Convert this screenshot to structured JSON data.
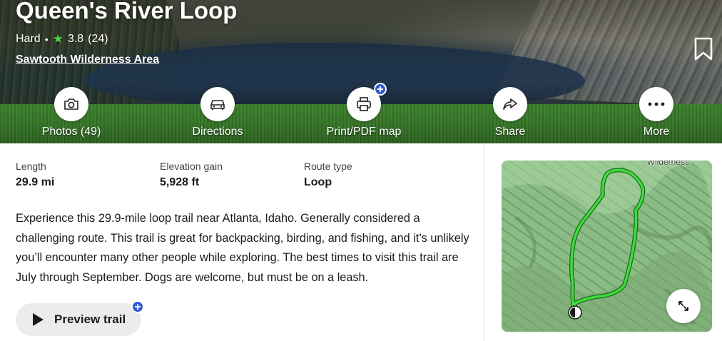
{
  "trail": {
    "title": "Queen's River Loop",
    "difficulty": "Hard",
    "separator": "•",
    "rating": "3.8",
    "review_count": "(24)",
    "area": "Sawtooth Wilderness Area"
  },
  "actions": [
    {
      "label": "Photos (49)",
      "icon": "camera-icon"
    },
    {
      "label": "Directions",
      "icon": "car-icon"
    },
    {
      "label": "Print/PDF map",
      "icon": "printer-icon",
      "badge": "plus"
    },
    {
      "label": "Share",
      "icon": "share-arrow-icon"
    },
    {
      "label": "More",
      "icon": "more-dots-icon"
    }
  ],
  "stats": [
    {
      "label": "Length",
      "value": "29.9 mi"
    },
    {
      "label": "Elevation gain",
      "value": "5,928 ft"
    },
    {
      "label": "Route type",
      "value": "Loop"
    }
  ],
  "description": "Experience this 29.9-mile loop trail near Atlanta, Idaho. Generally considered a challenging route. This trail is great for backpacking, birding, and fishing, and it’s unlikely you’ll encounter many other people while exploring. The best times to visit this trail are July through September. Dogs are welcome, but must be on a leash.",
  "preview": {
    "label": "Preview trail"
  },
  "map": {
    "label": "Wilderness"
  },
  "colors": {
    "star": "#4bd34b",
    "plus_badge": "#2f5ad8",
    "route": "#3ddc3d"
  }
}
